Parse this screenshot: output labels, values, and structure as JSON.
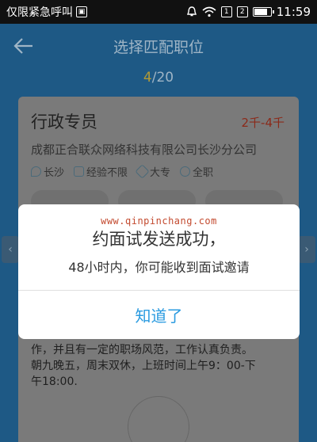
{
  "status_bar": {
    "carrier": "仅限紧急呼叫",
    "time": "11:59",
    "battery_level": 0.85
  },
  "header": {
    "title": "选择匹配职位",
    "pager_current": "4",
    "pager_total": "/20"
  },
  "job": {
    "title": "行政专员",
    "salary": "2千-4千",
    "company": "成都正合联众网络科技有限公司长沙分公司",
    "tags": {
      "city": "长沙",
      "experience": "经验不限",
      "education": "大专",
      "type": "全职"
    },
    "description": [
      "作，并且有一定的职场风范，工作认真负责。",
      "朝九晚五，周末双休，上班时间上午9：00-下",
      "午18:00."
    ]
  },
  "dialog": {
    "watermark": "www.qinpinchang.com",
    "title": "约面试发送成功，",
    "message": "48小时内，你可能收到面试邀请",
    "confirm_label": "知道了"
  }
}
